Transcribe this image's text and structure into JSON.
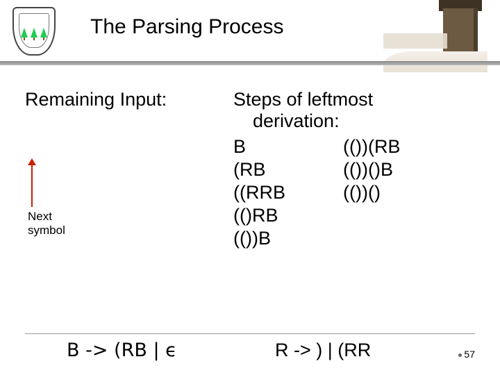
{
  "title": "The Parsing Process",
  "left": {
    "heading": "Remaining Input:",
    "next_symbol_l1": "Next",
    "next_symbol_l2": "symbol"
  },
  "right": {
    "heading_l1": "Steps of leftmost",
    "heading_l2": "derivation:",
    "rows": [
      {
        "a": "B",
        "b": "(())(RB"
      },
      {
        "a": "(RB",
        "b": "(())()B"
      },
      {
        "a": "((RRB",
        "b": "(())()"
      },
      {
        "a": "(()RB",
        "b": ""
      },
      {
        "a": "(())B",
        "b": ""
      }
    ]
  },
  "grammar": {
    "rule1": "B -> (RB | ϵ",
    "rule2": "R -> ) | (RR"
  },
  "page_number": "57"
}
